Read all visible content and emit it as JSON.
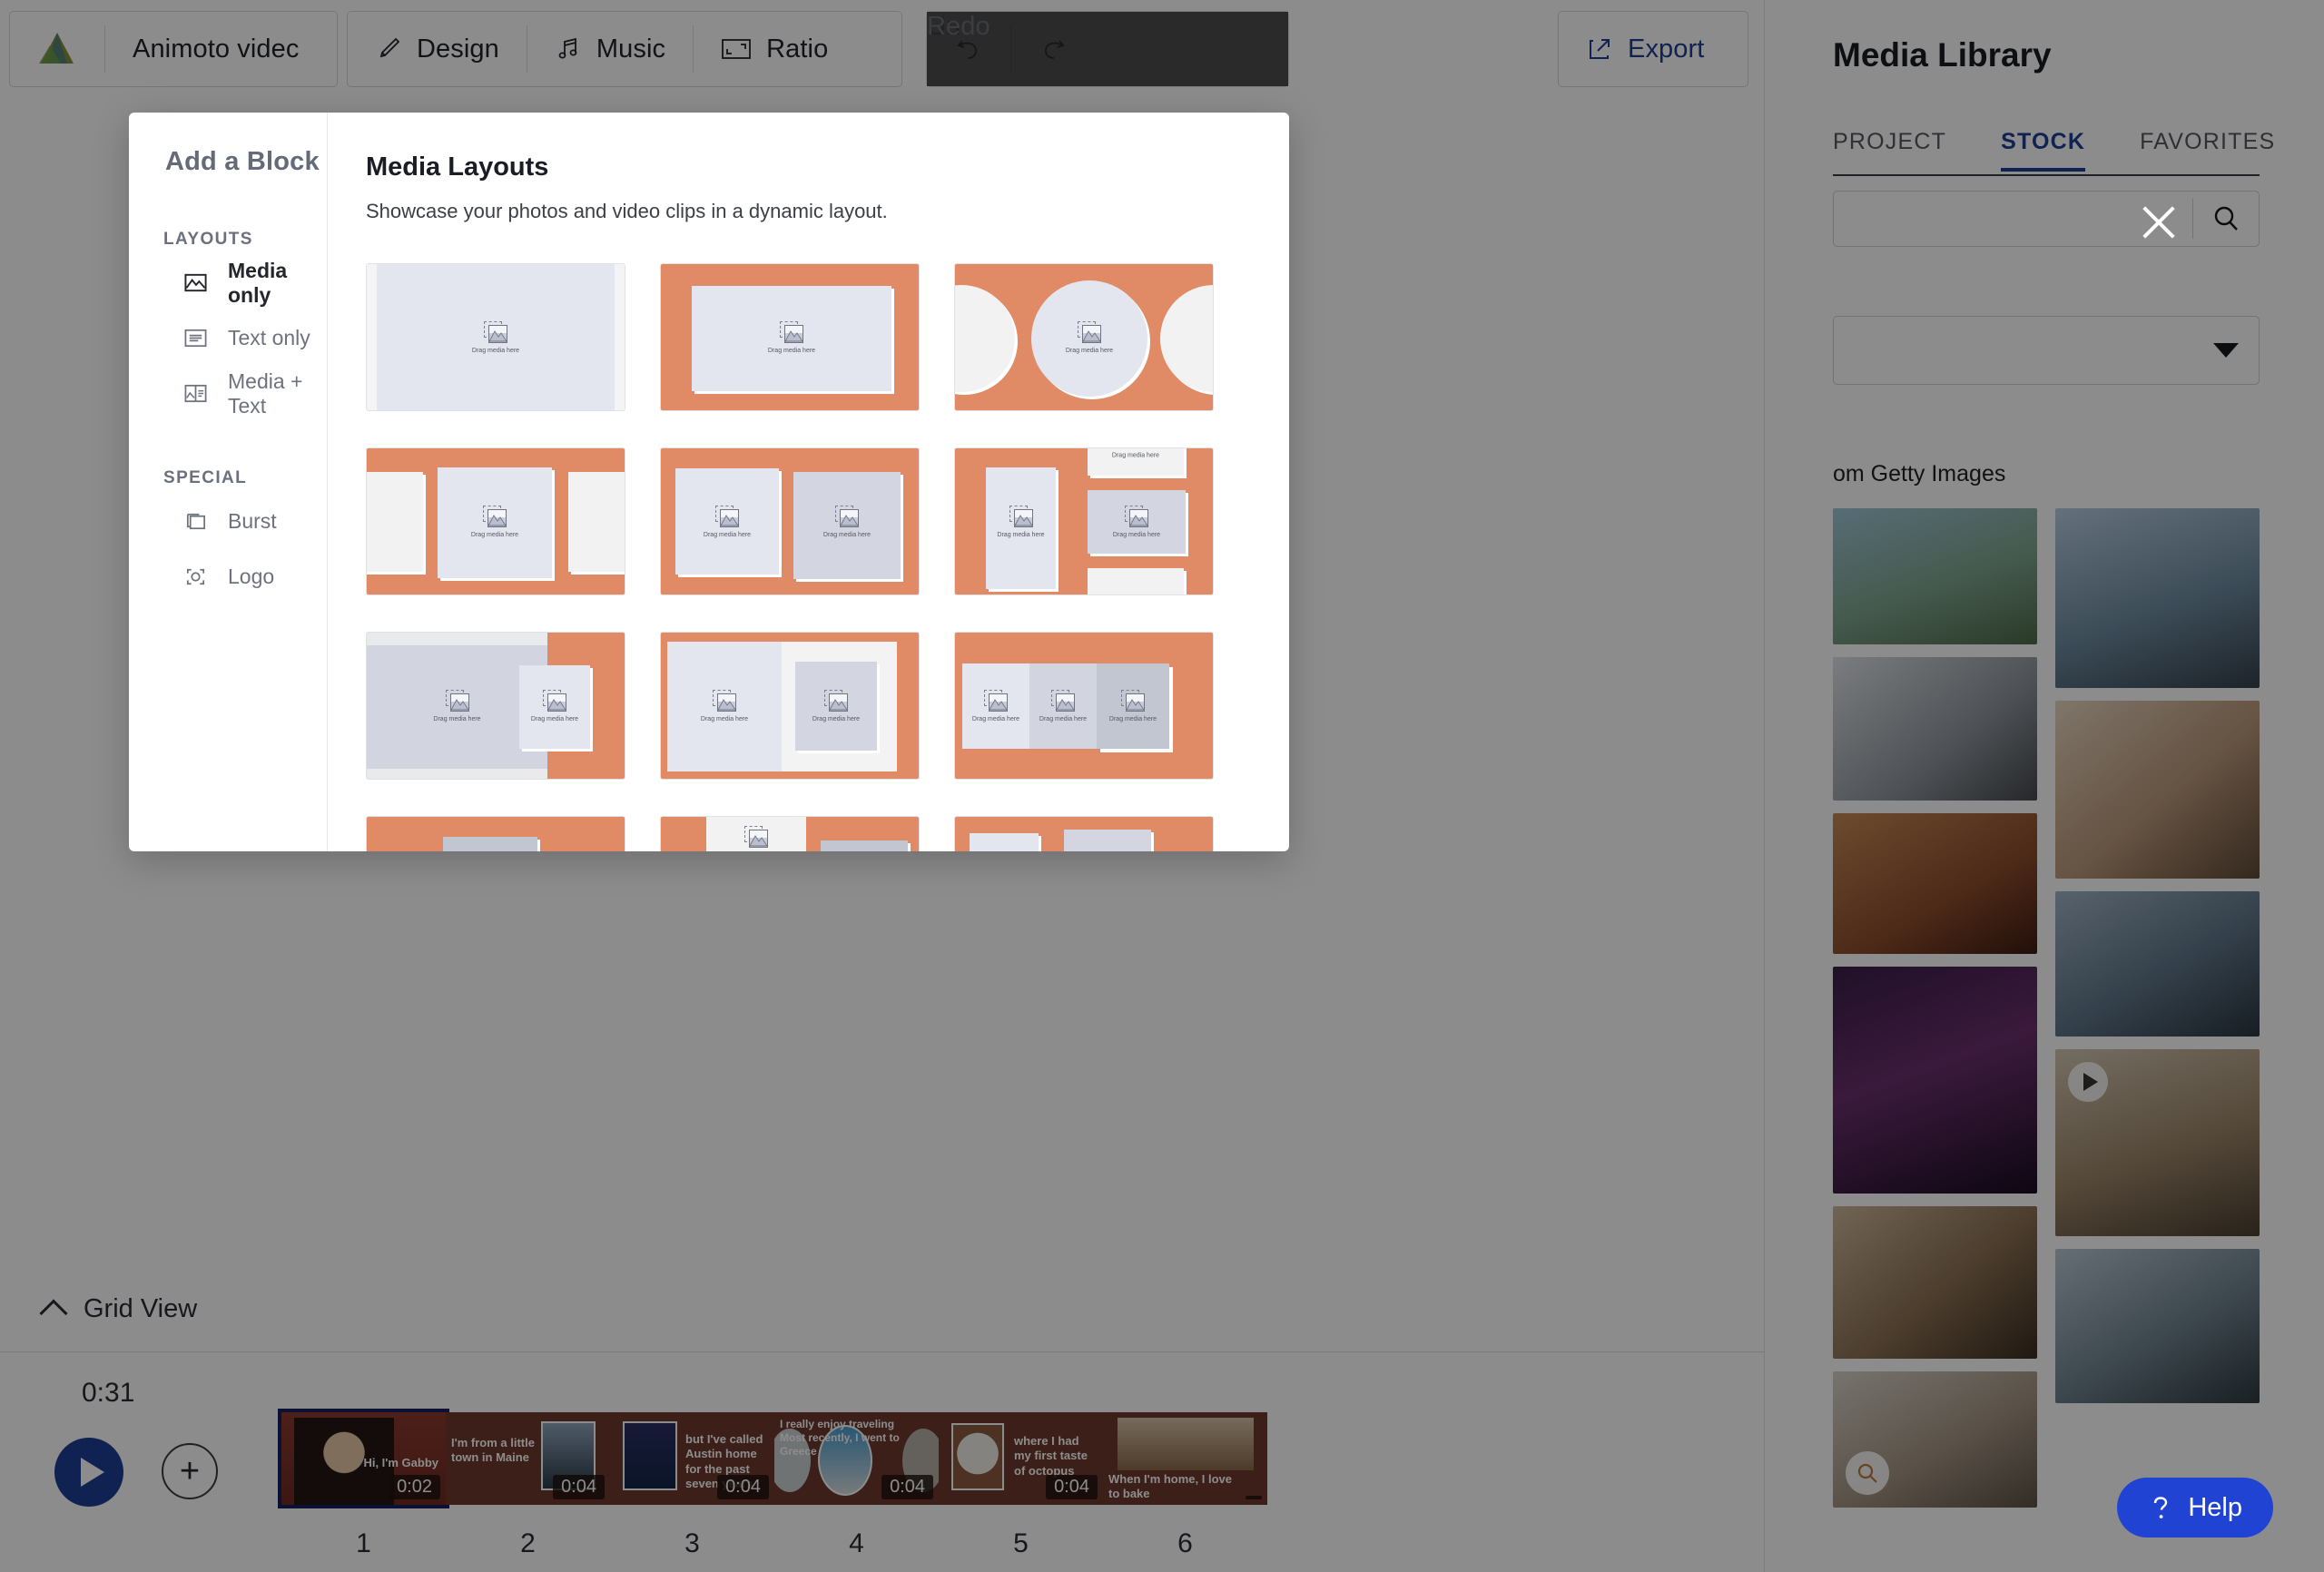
{
  "toolbar": {
    "project_name": "Animoto videc",
    "logo_icon": "animoto-logo-icon",
    "buttons": [
      {
        "label": "Design",
        "icon": "brush-icon",
        "disabled": false
      },
      {
        "label": "Music",
        "icon": "music-note-icon",
        "disabled": false
      },
      {
        "label": "Ratio",
        "icon": "aspect-ratio-icon",
        "disabled": false
      }
    ],
    "history": [
      {
        "label": "Undo",
        "icon": "undo-arrow-icon",
        "disabled": true
      },
      {
        "label": "Redo",
        "icon": "redo-arrow-icon",
        "disabled": true
      }
    ],
    "export": {
      "label": "Export",
      "icon": "export-icon"
    }
  },
  "media_library": {
    "title": "Media Library",
    "tabs": [
      {
        "label": "PROJECT",
        "active": false
      },
      {
        "label": "STOCK",
        "active": true
      },
      {
        "label": "FAVORITES",
        "active": false
      }
    ],
    "search": {
      "value": "",
      "placeholder": "",
      "icon": "search-icon"
    },
    "filter_select": {
      "value": "",
      "icon": "chevron-down-icon"
    },
    "source_note": "om Getty Images",
    "close_icon": "close-icon"
  },
  "modal": {
    "title": "Add a Block",
    "sections": [
      {
        "heading": "LAYOUTS",
        "items": [
          {
            "label": "Media only",
            "icon": "image-icon",
            "active": true
          },
          {
            "label": "Text only",
            "icon": "text-lines-icon",
            "active": false
          },
          {
            "label": "Media + Text",
            "icon": "media-text-icon",
            "active": false
          }
        ]
      },
      {
        "heading": "SPECIAL",
        "items": [
          {
            "label": "Burst",
            "icon": "stacked-cards-icon",
            "active": false
          },
          {
            "label": "Logo",
            "icon": "logo-frame-icon",
            "active": false
          }
        ]
      }
    ],
    "main": {
      "heading": "Media Layouts",
      "subheading": "Showcase your photos and video clips in a dynamic layout.",
      "placeholder_text": "Drag media here",
      "accent_color": "#e18a66",
      "layouts": [
        {
          "id": "full-bleed-single",
          "name": "Full bleed single media"
        },
        {
          "id": "framed-single",
          "name": "Framed single media"
        },
        {
          "id": "circles-carousel",
          "name": "Circle carousel"
        },
        {
          "id": "three-up-carousel",
          "name": "Three up carousel"
        },
        {
          "id": "two-up-squares",
          "name": "Two up squares"
        },
        {
          "id": "portrait-plus-stack",
          "name": "Portrait plus stacked trio"
        },
        {
          "id": "wide-plus-portrait",
          "name": "Wide media with portrait overlay"
        },
        {
          "id": "split-half-portrait",
          "name": "Split half with portrait"
        },
        {
          "id": "triple-portrait-row",
          "name": "Triple portrait row"
        },
        {
          "id": "offset-pair",
          "name": "Offset pair"
        },
        {
          "id": "stacked-split",
          "name": "Stacked split"
        },
        {
          "id": "partial-row",
          "name": "Partial row"
        }
      ]
    }
  },
  "bottom_bar": {
    "grid_view": {
      "label": "Grid View",
      "icon": "chevron-up-icon"
    },
    "total_duration": "0:31",
    "play_button": {
      "icon": "play-icon"
    },
    "add_block_button": {
      "icon": "plus-icon"
    },
    "clips": [
      {
        "number": "1",
        "duration": "0:02",
        "caption": "Hi, I'm Gabby",
        "selected": true
      },
      {
        "number": "2",
        "duration": "0:04",
        "caption": "I'm from a little town in Maine",
        "selected": false
      },
      {
        "number": "3",
        "duration": "0:04",
        "caption": "but I've called Austin home for the past seven years",
        "selected": false
      },
      {
        "number": "4",
        "duration": "0:04",
        "caption": "I really enjoy traveling Most recently, I went to Greece",
        "selected": false
      },
      {
        "number": "5",
        "duration": "0:04",
        "caption": "where I had my first taste of octopus",
        "selected": false
      },
      {
        "number": "6",
        "duration": "",
        "caption": "When I'm home, I love to bake",
        "selected": false
      }
    ]
  },
  "help": {
    "label": "Help",
    "icon": "question-mark-icon",
    "color": "#2143d4"
  }
}
